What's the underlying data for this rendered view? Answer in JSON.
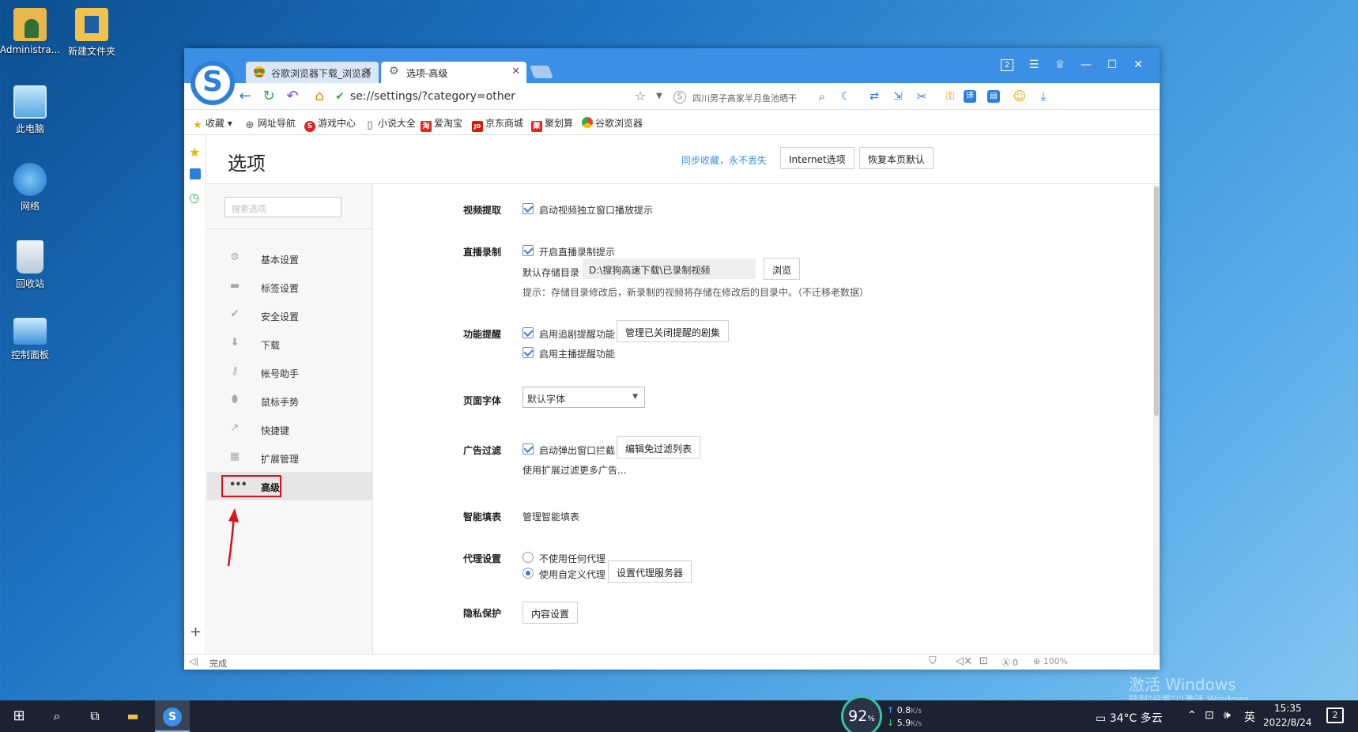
{
  "desktop": {
    "icons": [
      {
        "label": "Administra...",
        "icon": "user-folder-icon",
        "color": "#e8b74a"
      },
      {
        "label": "新建文件夹",
        "icon": "folder-icon",
        "color": "#f3c24c"
      },
      {
        "label": "此电脑",
        "icon": "computer-icon",
        "color": "#9fd3f5"
      },
      {
        "label": "网络",
        "icon": "network-icon",
        "color": "#4aa3e6"
      },
      {
        "label": "回收站",
        "icon": "recycle-bin-icon",
        "color": "#d8e6f2"
      },
      {
        "label": "控制面板",
        "icon": "control-panel-icon",
        "color": "#5ab0ee"
      }
    ],
    "watermark_line1": "激活 Windows",
    "watermark_line2": "转到\"设置\"以激活 Windows。"
  },
  "browser": {
    "tabs": [
      {
        "label": "谷歌浏览器下载_浏览器",
        "icon": "chrome-icon",
        "active": false
      },
      {
        "label": "选项-高级",
        "icon": "gear-icon",
        "active": true
      }
    ],
    "window_badge": "2",
    "url": "se://settings/?category=other",
    "search_placeholder": "四川男子高家半月鱼池晒干",
    "bookmarks": [
      {
        "label": "收藏",
        "icon": "star-icon",
        "color": "#f0b400",
        "glyph": ""
      },
      {
        "label": "网址导航",
        "icon": "globe-icon",
        "color": "#777",
        "glyph": ""
      },
      {
        "label": "游戏中心",
        "icon": "game-icon",
        "color": "#e02020",
        "glyph": "S"
      },
      {
        "label": "小说大全",
        "icon": "book-icon",
        "color": "#555",
        "glyph": ""
      },
      {
        "label": "爱淘宝",
        "icon": "taobao-icon",
        "color": "#e8261e",
        "glyph": "淘"
      },
      {
        "label": "京东商城",
        "icon": "jd-icon",
        "color": "#d81e06",
        "glyph": "JD"
      },
      {
        "label": "聚划算",
        "icon": "juhuasuan-icon",
        "color": "#e8261e",
        "glyph": "聚"
      },
      {
        "label": "谷歌浏览器",
        "icon": "chrome-icon",
        "color": "#4285f4",
        "glyph": ""
      }
    ]
  },
  "settings": {
    "title": "选项",
    "sync_link": "同步收藏，永不丢失",
    "internet_options_button": "Internet选项",
    "restore_defaults_button": "恢复本页默认",
    "search_placeholder": "搜索选项",
    "nav": [
      {
        "label": "基本设置",
        "icon": "gear-icon",
        "glyph": "⚙"
      },
      {
        "label": "标签设置",
        "icon": "tab-icon",
        "glyph": "▬"
      },
      {
        "label": "安全设置",
        "icon": "shield-check-icon",
        "glyph": "✔"
      },
      {
        "label": "下载",
        "icon": "download-icon",
        "glyph": "⬇"
      },
      {
        "label": "帐号助手",
        "icon": "key-icon",
        "glyph": "🔍"
      },
      {
        "label": "鼠标手势",
        "icon": "mouse-icon",
        "glyph": "●"
      },
      {
        "label": "快捷键",
        "icon": "shortcut-arrow-icon",
        "glyph": "↗"
      },
      {
        "label": "扩展管理",
        "icon": "extensions-icon",
        "glyph": "▦"
      },
      {
        "label": "高级",
        "icon": "more-dots-icon",
        "glyph": "•••",
        "active": true
      }
    ],
    "sections": {
      "video": {
        "label": "视频提取",
        "checkbox1": "启动视频独立窗口播放提示"
      },
      "live": {
        "label": "直播录制",
        "checkbox1": "开启直播录制提示",
        "dir_label": "默认存储目录",
        "dir_value": "D:\\搜狗高速下载\\已录制视频",
        "browse_button": "浏览",
        "hint": "提示：存储目录修改后，新录制的视频将存储在修改后的目录中。（不迁移老数据）"
      },
      "reminder": {
        "label": "功能提醒",
        "checkbox1": "启用追剧提醒功能",
        "manage_button": "管理已关闭提醒的剧集",
        "checkbox2": "启用主播提醒功能"
      },
      "font": {
        "label": "页面字体",
        "select_value": "默认字体"
      },
      "adblock": {
        "label": "广告过滤",
        "checkbox1": "启动弹出窗口拦截",
        "edit_button": "编辑免过滤列表",
        "more_link": "使用扩展过滤更多广告..."
      },
      "autofill": {
        "label": "智能填表",
        "manage_link": "管理智能填表"
      },
      "proxy": {
        "label": "代理设置",
        "radio1": "不使用任何代理",
        "radio2": "使用自定义代理",
        "set_button": "设置代理服务器"
      },
      "privacy": {
        "label": "隐私保护",
        "button": "内容设置"
      }
    }
  },
  "statusbar": {
    "status": "完成",
    "ad_count": "0",
    "zoom": "100%"
  },
  "taskbar": {
    "net_percent": "92",
    "net_unit": "%",
    "upload": "0.8",
    "download": "5.9",
    "speed_unit": "K/s",
    "weather": "34°C 多云",
    "ime": "英",
    "time": "15:35",
    "date": "2022/8/24",
    "notification_count": "2"
  }
}
